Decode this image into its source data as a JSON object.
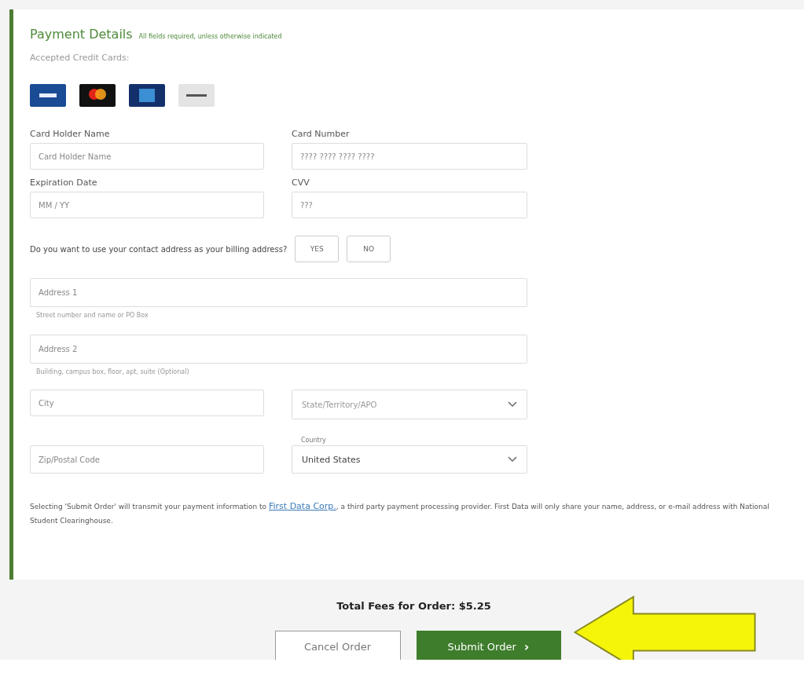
{
  "payment": {
    "title": "Payment Details",
    "note": "All fields required, unless otherwise indicated",
    "accepted_label": "Accepted Credit Cards:",
    "cards": [
      {
        "kind": "visa"
      },
      {
        "kind": "mastercard"
      },
      {
        "kind": "amex"
      },
      {
        "kind": "discover"
      }
    ],
    "card_holder": {
      "label": "Card Holder Name",
      "placeholder": "Card Holder Name"
    },
    "card_number": {
      "label": "Card Number",
      "placeholder": "???? ???? ???? ????"
    },
    "expiration": {
      "label": "Expiration Date",
      "placeholder": "MM / YY"
    },
    "cvv": {
      "label": "CVV",
      "placeholder": "???"
    },
    "billing_question": "Do you want to use your contact address as your billing address?",
    "billing_options": [
      {
        "label": "YES",
        "selected": false
      },
      {
        "label": "NO",
        "selected": false
      }
    ],
    "address1": {
      "placeholder": "Address 1",
      "hint": "Street number and name or PO Box"
    },
    "address2": {
      "placeholder": "Address 2",
      "hint": "Building, campus box, floor, apt, suite (Optional)"
    },
    "city": {
      "placeholder": "City"
    },
    "state": {
      "placeholder": "State/Territory/APO"
    },
    "zip": {
      "placeholder": "Zip/Postal Code"
    },
    "country": {
      "label": "Country",
      "value": "United States"
    },
    "disclaimer_before": "Selecting 'Submit Order' will transmit your payment information to ",
    "disclaimer_link": "First Data Corp.",
    "disclaimer_after": ", a third party payment processing provider. First Data will only share your name, address, or e-mail address with National Student Clearinghouse."
  },
  "total": "Total Fees for Order: $5.25",
  "buttons": {
    "cancel": "Cancel Order",
    "submit": "Submit Order",
    "submit_icon": "›"
  }
}
